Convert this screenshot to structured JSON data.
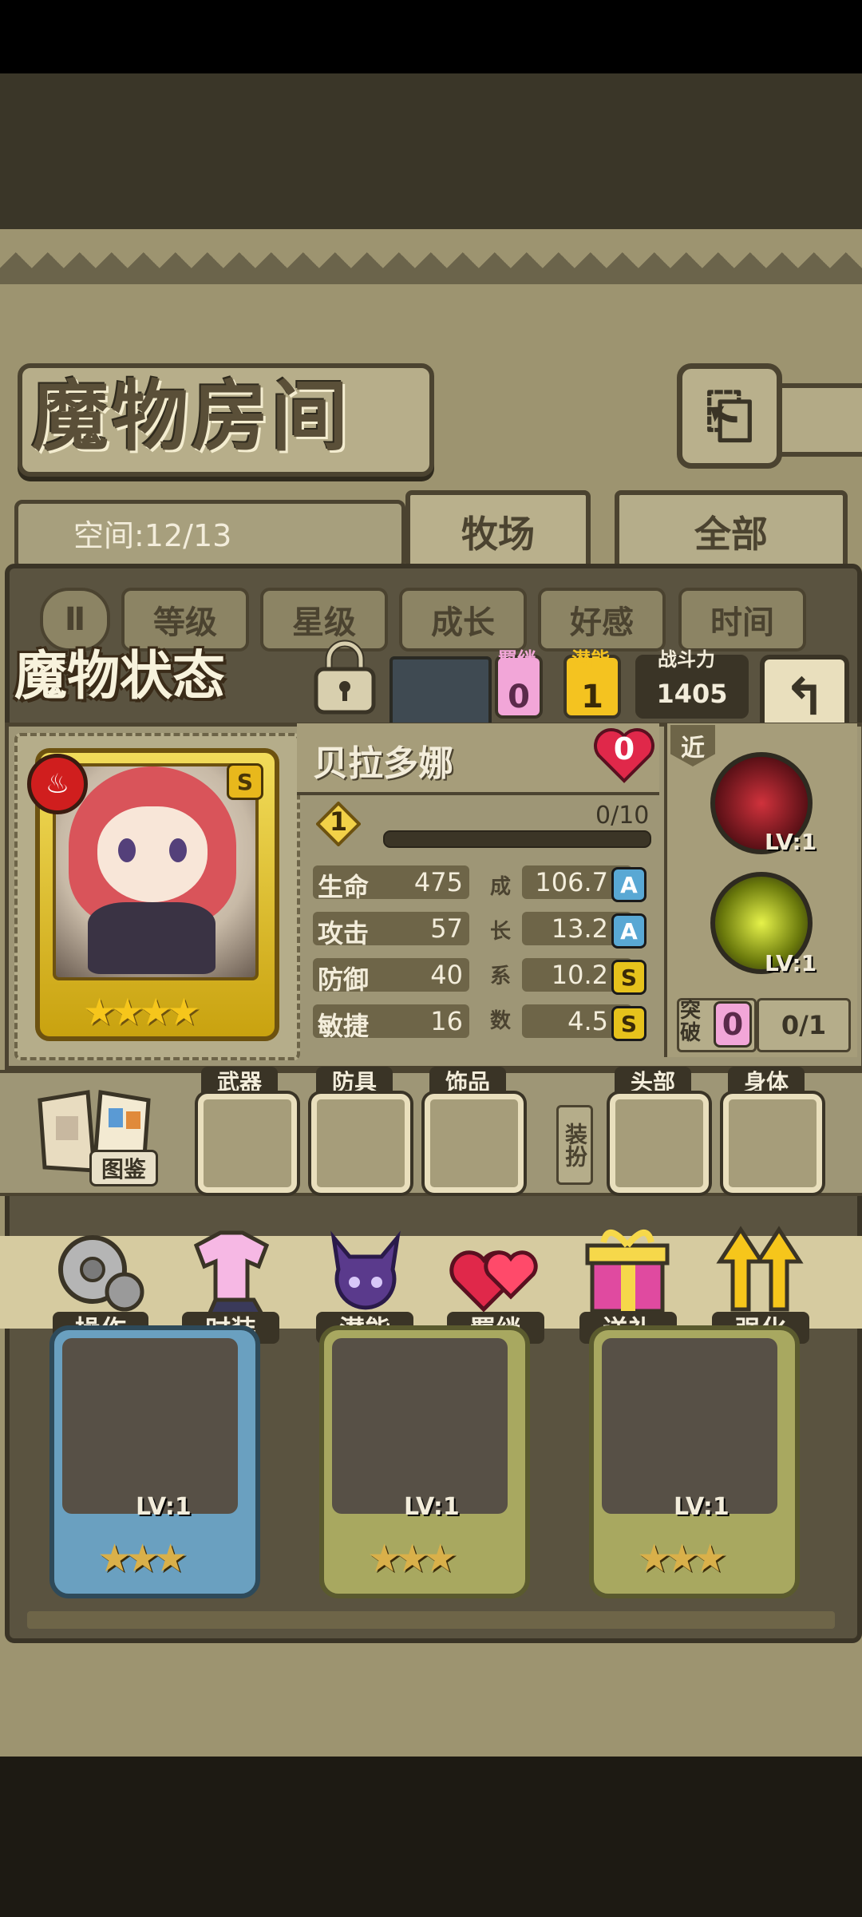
{
  "header": {
    "title": "魔物房间",
    "back_icon": "return-icon"
  },
  "space": {
    "label": "空间:12/13"
  },
  "tabs": [
    {
      "label": "牧场",
      "active": true
    },
    {
      "label": "全部",
      "active": false
    }
  ],
  "sort": {
    "toggle_label": "Ⅱ",
    "buttons": [
      "等级",
      "星级",
      "成长",
      "好感",
      "时间"
    ]
  },
  "status": {
    "title": "魔物状态",
    "bond": {
      "label": "羁绊",
      "value": "0"
    },
    "potential": {
      "label": "潜能",
      "value": "1"
    },
    "power": {
      "label": "战斗力",
      "value": "1405"
    }
  },
  "monster": {
    "name": "贝拉多娜",
    "affection": "0",
    "element_icon": "fire-icon",
    "rank_badge": "S",
    "stars": "★★★★",
    "level": "1",
    "exp": "0/10",
    "exp_progress": 0.0,
    "growth_column": [
      "成",
      "长",
      "系",
      "数"
    ],
    "stats": [
      {
        "name": "生命",
        "value": "475",
        "growth": "106.7",
        "grade": "A"
      },
      {
        "name": "攻击",
        "value": "57",
        "growth": "13.2",
        "grade": "A"
      },
      {
        "name": "防御",
        "value": "40",
        "growth": "10.2",
        "grade": "S"
      },
      {
        "name": "敏捷",
        "value": "16",
        "growth": "4.5",
        "grade": "S"
      }
    ],
    "range": "近",
    "skills": [
      {
        "lv": "LV:1"
      },
      {
        "lv": "LV:1"
      }
    ],
    "breakthrough": {
      "label": "突破",
      "value": "0",
      "progress": "0/1"
    }
  },
  "equipment": {
    "codex_label": "图鉴",
    "dress_label": "装扮",
    "slots": [
      "武器",
      "防具",
      "饰品",
      "头部",
      "身体"
    ]
  },
  "actions": [
    "操作",
    "时装",
    "潜能",
    "羁绊",
    "送礼",
    "强化"
  ],
  "cards": [
    {
      "lv": "LV:1",
      "stars": "★★★"
    },
    {
      "lv": "LV:1",
      "stars": "★★★"
    },
    {
      "lv": "LV:1",
      "stars": "★★★"
    }
  ],
  "colors": {
    "accent_gold": "#f6c61b",
    "frame_dark": "#4b4330",
    "fire_red": "#d01e1e"
  }
}
